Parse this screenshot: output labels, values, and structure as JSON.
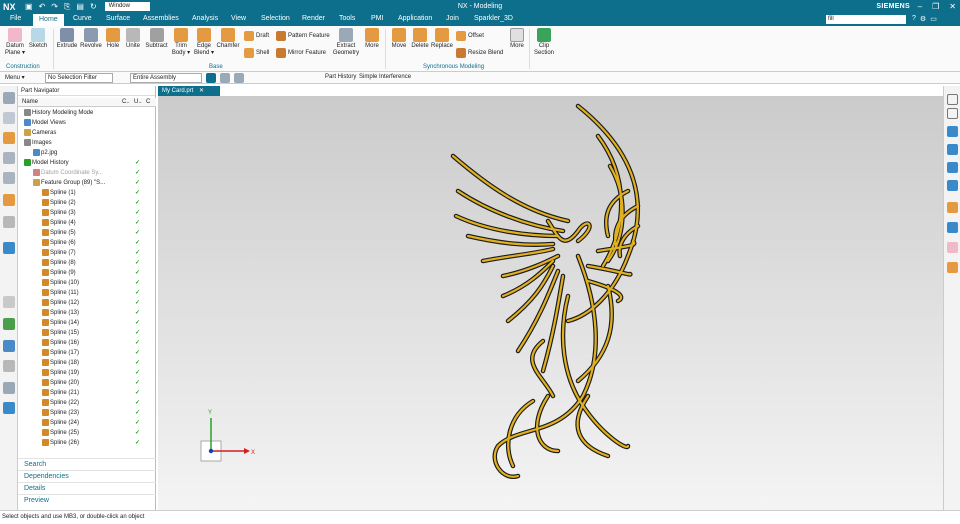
{
  "app": {
    "logo": "NX",
    "title": "NX - Modeling",
    "brand": "SIEMENS",
    "window_menu": "Window"
  },
  "menu": {
    "tabs": [
      "File",
      "Home",
      "Curve",
      "Surface",
      "Assemblies",
      "Analysis",
      "View",
      "Selection",
      "Render",
      "Tools",
      "PMI",
      "Application",
      "Join",
      "Sparkler_3D"
    ],
    "active": "Home",
    "search_value": "fill"
  },
  "ribbon": {
    "construction": {
      "label": "Construction",
      "buttons": [
        "Datum Plane ▾",
        "Sketch"
      ]
    },
    "base": {
      "label": "Base",
      "buttons": [
        "Extrude",
        "Revolve",
        "Hole",
        "Unite",
        "Subtract",
        "Trim Body ▾",
        "Edge Blend ▾",
        "Chamfer"
      ],
      "small_buttons": [
        "Draft",
        "Pattern Feature",
        "Shell",
        "Mirror Feature"
      ],
      "extract": "Extract Geometry",
      "more": "More"
    },
    "synchronous": {
      "label": "Synchronous Modeling",
      "buttons": [
        "Move",
        "Delete",
        "Replace"
      ],
      "small_buttons": [
        "Offset",
        "Resize Blend"
      ],
      "more": "More"
    },
    "clip": "Clip Section"
  },
  "toolbar": {
    "menu": "Menu ▾",
    "selection_filter": "No Selection Filter",
    "assembly": "Entire Assembly",
    "part_history": "Part History",
    "simple_interference": "Simple Interference"
  },
  "document_tab": "My Card.prt",
  "navigator": {
    "title": "Part Navigator",
    "columns": {
      "name": "Name",
      "c": "C..",
      "u": "U..",
      "extra": "C"
    },
    "rows": [
      {
        "indent": 0,
        "label": "History Modeling Mode",
        "color": "#888"
      },
      {
        "indent": 0,
        "label": "Model Views",
        "color": "#4a8ac9"
      },
      {
        "indent": 0,
        "label": "Cameras",
        "color": "#c9a24a"
      },
      {
        "indent": 0,
        "label": "Images",
        "color": "#888"
      },
      {
        "indent": 1,
        "label": "p2.jpg",
        "color": "#4a8ac9"
      },
      {
        "indent": 0,
        "label": "Model History",
        "color": "#2aa02a",
        "check": true
      },
      {
        "indent": 1,
        "label": "Datum Coordinate Sy...",
        "color": "#d38080",
        "check": true,
        "dim": true
      },
      {
        "indent": 1,
        "label": "Feature Group (89) \"S...",
        "color": "#c9a24a",
        "check": true
      },
      {
        "indent": 2,
        "label": "Spline (1)",
        "color": "#d08a2a",
        "check": true
      },
      {
        "indent": 2,
        "label": "Spline (2)",
        "color": "#d08a2a",
        "check": true
      },
      {
        "indent": 2,
        "label": "Spline (3)",
        "color": "#d08a2a",
        "check": true
      },
      {
        "indent": 2,
        "label": "Spline (4)",
        "color": "#d08a2a",
        "check": true
      },
      {
        "indent": 2,
        "label": "Spline (5)",
        "color": "#d08a2a",
        "check": true
      },
      {
        "indent": 2,
        "label": "Spline (6)",
        "color": "#d08a2a",
        "check": true
      },
      {
        "indent": 2,
        "label": "Spline (7)",
        "color": "#d08a2a",
        "check": true
      },
      {
        "indent": 2,
        "label": "Spline (8)",
        "color": "#d08a2a",
        "check": true
      },
      {
        "indent": 2,
        "label": "Spline (9)",
        "color": "#d08a2a",
        "check": true
      },
      {
        "indent": 2,
        "label": "Spline (10)",
        "color": "#d08a2a",
        "check": true
      },
      {
        "indent": 2,
        "label": "Spline (11)",
        "color": "#d08a2a",
        "check": true
      },
      {
        "indent": 2,
        "label": "Spline (12)",
        "color": "#d08a2a",
        "check": true
      },
      {
        "indent": 2,
        "label": "Spline (13)",
        "color": "#d08a2a",
        "check": true
      },
      {
        "indent": 2,
        "label": "Spline (14)",
        "color": "#d08a2a",
        "check": true
      },
      {
        "indent": 2,
        "label": "Spline (15)",
        "color": "#d08a2a",
        "check": true
      },
      {
        "indent": 2,
        "label": "Spline (16)",
        "color": "#d08a2a",
        "check": true
      },
      {
        "indent": 2,
        "label": "Spline (17)",
        "color": "#d08a2a",
        "check": true
      },
      {
        "indent": 2,
        "label": "Spline (18)",
        "color": "#d08a2a",
        "check": true
      },
      {
        "indent": 2,
        "label": "Spline (19)",
        "color": "#d08a2a",
        "check": true
      },
      {
        "indent": 2,
        "label": "Spline (20)",
        "color": "#d08a2a",
        "check": true
      },
      {
        "indent": 2,
        "label": "Spline (21)",
        "color": "#d08a2a",
        "check": true
      },
      {
        "indent": 2,
        "label": "Spline (22)",
        "color": "#d08a2a",
        "check": true
      },
      {
        "indent": 2,
        "label": "Spline (23)",
        "color": "#d08a2a",
        "check": true
      },
      {
        "indent": 2,
        "label": "Spline (24)",
        "color": "#d08a2a",
        "check": true
      },
      {
        "indent": 2,
        "label": "Spline (25)",
        "color": "#d08a2a",
        "check": true
      },
      {
        "indent": 2,
        "label": "Spline (26)",
        "color": "#d08a2a",
        "check": true
      }
    ],
    "panels": [
      "Search",
      "Dependencies",
      "Details",
      "Preview"
    ]
  },
  "triad": {
    "x": "X",
    "y": "Y"
  },
  "status": "Select objects and use MB3, or double-click an object",
  "colors": {
    "accent": "#0e6f8d",
    "curve": "#e0b020",
    "check": "#2a9d2a"
  }
}
